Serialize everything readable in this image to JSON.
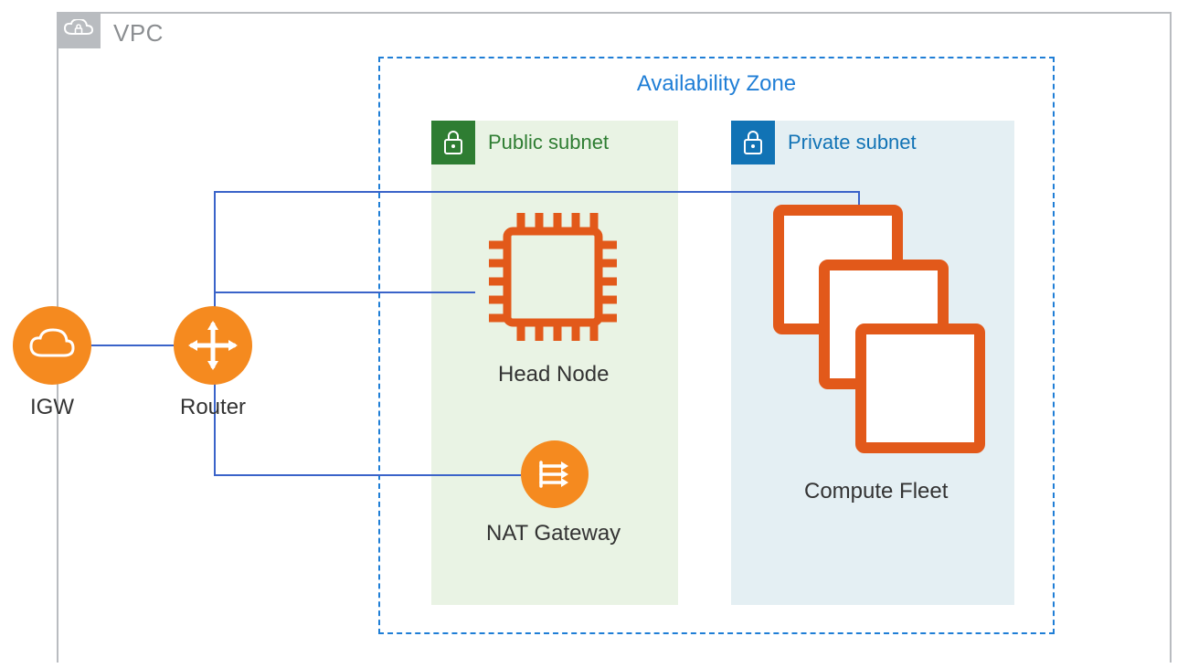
{
  "vpc": {
    "label": "VPC"
  },
  "az": {
    "label": "Availability Zone"
  },
  "public_subnet": {
    "label": "Public subnet"
  },
  "private_subnet": {
    "label": "Private subnet"
  },
  "igw": {
    "label": "IGW"
  },
  "router": {
    "label": "Router"
  },
  "head_node": {
    "label": "Head Node"
  },
  "nat_gateway": {
    "label": "NAT Gateway"
  },
  "compute_fleet": {
    "label": "Compute Fleet"
  },
  "colors": {
    "orange": "#f58a1f",
    "az_blue": "#1f7ed6",
    "subnet_green": "#2e7d32",
    "subnet_blue": "#1173b5",
    "wire": "#3a63c9",
    "vpc_grey": "#b9bcc0"
  },
  "connections": [
    {
      "from": "igw",
      "to": "router"
    },
    {
      "from": "router",
      "to": "head_node"
    },
    {
      "from": "router",
      "to": "nat_gateway"
    },
    {
      "from": "router",
      "to": "compute_fleet"
    }
  ]
}
